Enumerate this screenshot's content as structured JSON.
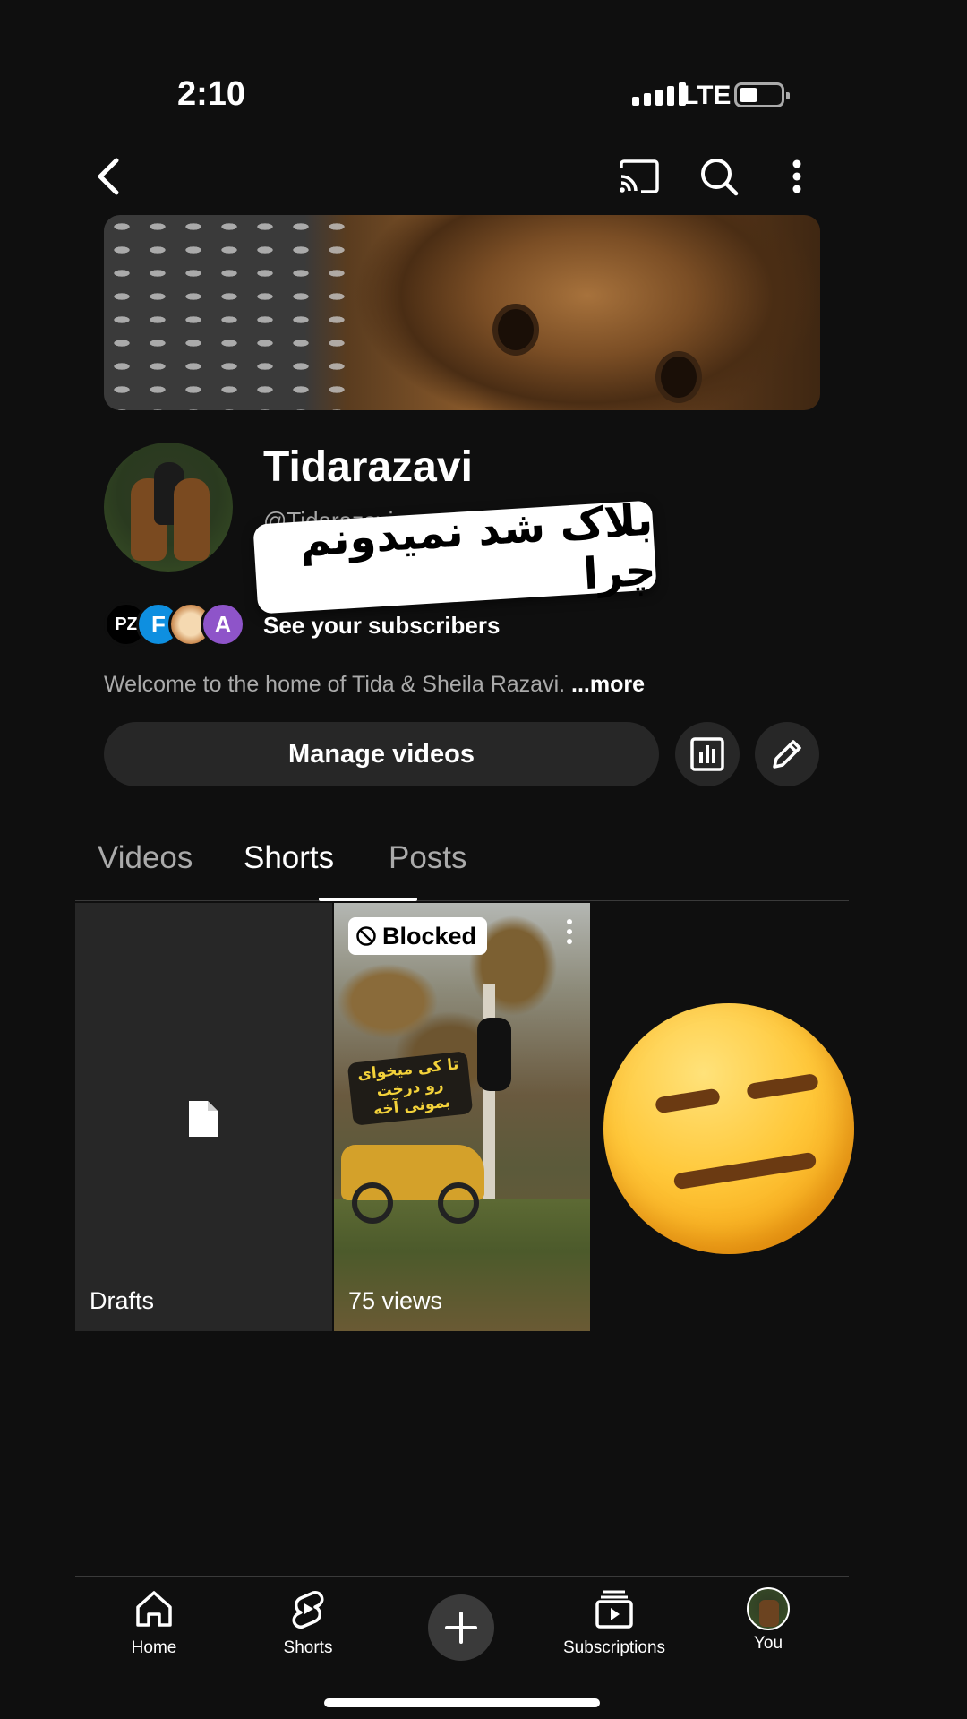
{
  "status_bar": {
    "time": "2:10",
    "network": "LTE"
  },
  "channel": {
    "name": "Tidarazavi",
    "handle": "@Tidarazavi",
    "see_subscribers": "See your subscribers",
    "subscriber_avatars": [
      "PZ",
      "F",
      "",
      "A"
    ],
    "description": "Welcome to the home of Tida & Sheila Razavi.",
    "more_label": "...more"
  },
  "sticker_text": "بلاک شد نمیدونم چرا",
  "actions": {
    "manage_videos": "Manage videos"
  },
  "tabs": [
    "Videos",
    "Shorts",
    "Posts"
  ],
  "active_tab": "Shorts",
  "grid": {
    "drafts_label": "Drafts",
    "short": {
      "badge": "Blocked",
      "views": "75 views",
      "caption": "تا کی میخوای رو درخت بمونی آخه"
    }
  },
  "nav": {
    "home": "Home",
    "shorts": "Shorts",
    "subscriptions": "Subscriptions",
    "you": "You"
  },
  "colors": {
    "background": "#0f0f0f",
    "surface": "#272727",
    "text": "#f1f1f1",
    "muted": "#aaaaaa",
    "avatar_f": "#0e8fe0",
    "avatar_a": "#8e54c9"
  },
  "icons": [
    "back-icon",
    "cast-icon",
    "search-icon",
    "more-vert-icon",
    "analytics-icon",
    "edit-pencil-icon",
    "document-icon",
    "blocked-icon",
    "home-icon",
    "shorts-icon",
    "create-plus-icon",
    "subscriptions-icon"
  ]
}
